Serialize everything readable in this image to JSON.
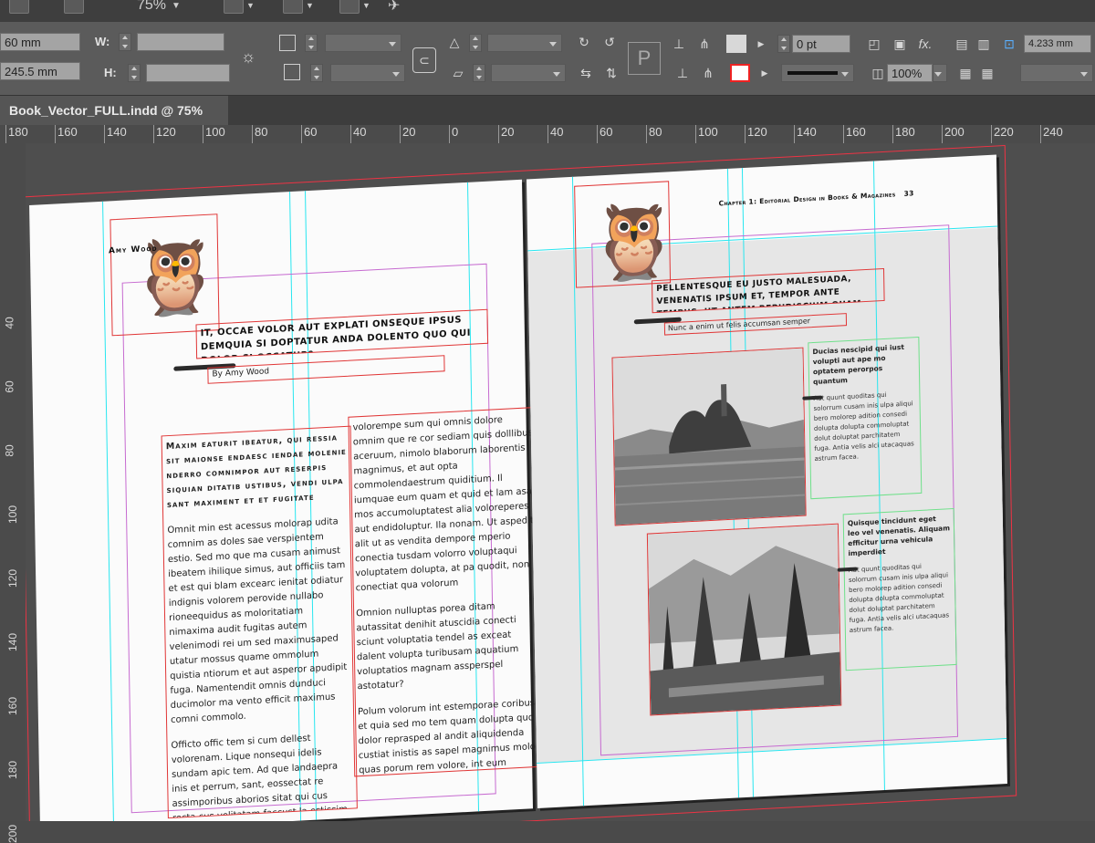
{
  "menubar": {
    "zoom": "75%"
  },
  "control": {
    "x_value": "60 mm",
    "y_value": "245.5 mm",
    "w_label": "W:",
    "h_label": "H:",
    "stroke_weight": "0 pt",
    "opacity": "100%",
    "gutter": "4.233 mm"
  },
  "doc": {
    "tab_title": "Book_Vector_FULL.indd @ 75%"
  },
  "ruler": {
    "h_ticks": [
      "180",
      "160",
      "140",
      "120",
      "100",
      "80",
      "60",
      "40",
      "20",
      "0",
      "20",
      "40",
      "60",
      "80",
      "100",
      "120",
      "140",
      "160",
      "180",
      "200",
      "220",
      "240"
    ],
    "v_ticks": [
      "40",
      "60",
      "80",
      "100",
      "120",
      "140",
      "160",
      "180",
      "200"
    ]
  },
  "left_page": {
    "running_head": "Amy Wood",
    "title": "It, occae volor aut explati onseque ipsus demquia si doptatur anda dolento quo qui dolor si occatur?",
    "byline": "By Amy Wood",
    "col1_caps": "Maxim eaturit ibeatur, qui ressia sit maionse endaesc iendae molenie nderro comnimpor aut reserpis siquian ditatib ustibus, vendi ulpa sant maximent et et fugitate",
    "col1_p1": "Omnit min est acessus molorap udita comnim as doles sae verspientem estio. Sed mo que ma cusam animust ibeatem ihilique simus, aut officiis tam et est qui blam excearc ienitat odiatur indignis volorem perovide nullabo rioneequidus as moloritatiam nimaxima audit fugitas autem velenimodi rei um sed maximusaped utatur mossus quame ommolum quistia ntiorum et aut asperor apudipit fuga. Namentendit omnis dunduci ducimolor ma vento efficit maximus comni commolo.",
    "col1_p2": "Officto offic tem si cum dellest volorenam. Lique nonsequi idelis sundam apic tem. Ad que landaepra inis et perrum, sant, eossectat re assimporibus aborios sitat qui cus recta cus velitatam faccust la estissim volicia sedit",
    "col2_p1": "volorempe sum qui omnis dolore omnim que re cor sediam quis dolllibus aceruum, nimolo blaborum laborentis magnimus, et aut opta commolendaestrum quiditium. Il iumquae eum quam et quid et lam asad mos accumoluptatest alia voloreperes aut endidoluptur. Ila nonam. Ut aspedit, alit ut as vendita dempore mperio conectia tusdam volorro voluptaqui voluptatem dolupta, at pa quodit, non conectiat qua volorum",
    "col2_p2": "Omnion nulluptas porea ditam autassitat denihit atuscidia conecti sciunt voluptatia tendel as exceat dalent volupta turibusam aquatium voluptatios magnam assperspel astotatur?",
    "col2_p3": "Polum volorum int estemporae coribus et quia sed mo tem quam dolupta quo dolor reprasped al andit aliquidenda custiat inistis as sapel magnimus molor quas porum rem volore, int eum duntam tum re nobisci psantur iatur re accus accumam ditsasped qui corro totaudis volorum rest, cus atem quat."
  },
  "right_page": {
    "running_head": "Chapter 1: Editorial Design in Books & Magazines",
    "page_number": "33",
    "title": "Pellentesque eu justo malesuada, venenatis ipsum et, tempor ante tempus, ut antem repudiscium quam",
    "subtitle": "Nunc a enim ut felis accumsan semper",
    "caption1_head": "Ducias nescipid qui iust volupti aut ape mo optatem perorpos quantum",
    "caption1_body": "Aut quunt quoditas qui solorrum cusam inis ulpa aliqui bero molorep adition consedi dolupta dolupta commoluptat dolut doluptat parchitatem fuga. Antia velis alci utacaquas astrum facea.",
    "caption2_head": "Quisque tincidunt eget leo vel venenatis. Aliquam efficitur urna vehicula imperdiet",
    "caption2_body": "Aut quunt quoditas qui solorrum cusam inis ulpa aliqui bero molorep adition consedi dolupta dolupta commoluptat dolut doluptat parchitatem fuga. Antia velis alci utacaquas astrum facea."
  }
}
